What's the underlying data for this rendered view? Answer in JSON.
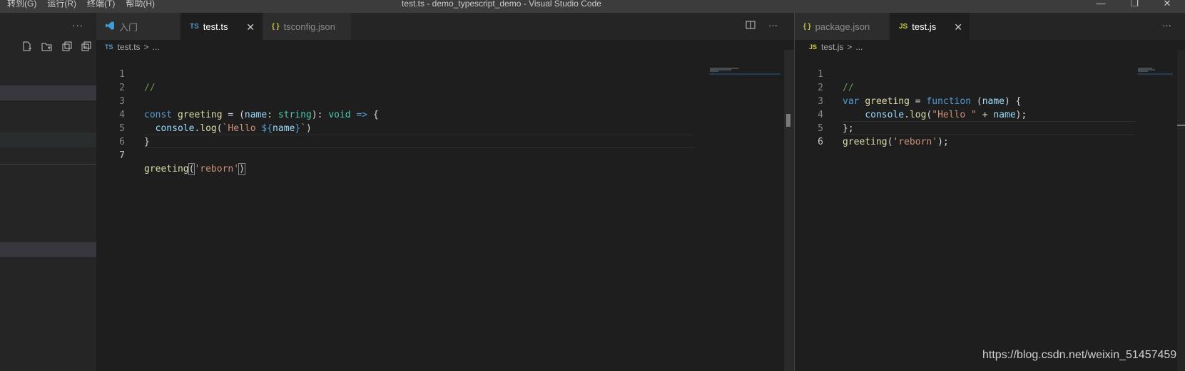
{
  "titlebar": {
    "menu": [
      "转到(G)",
      "运行(R)",
      "终端(T)",
      "帮助(H)"
    ],
    "title": "test.ts - demo_typescript_demo - Visual Studio Code",
    "controls": {
      "minimize": "—",
      "restore": "❐",
      "close": "✕"
    }
  },
  "sidebar": {
    "more": "···",
    "actions": [
      "new-file-icon",
      "new-folder-icon",
      "refresh-icon",
      "collapse-all-icon"
    ]
  },
  "left_group": {
    "tabs": [
      {
        "icon": "vscode-icon",
        "label": "入门"
      },
      {
        "icon": "TS",
        "label": "test.ts",
        "close": "✕"
      },
      {
        "icon": "{ }",
        "label": "tsconfig.json"
      }
    ],
    "actions": {
      "split": "split-editor-icon",
      "more": "···"
    },
    "breadcrumb": {
      "icon": "TS",
      "file": "test.ts",
      "sep": ">",
      "rest": "..."
    },
    "lines": [
      {
        "n": "1",
        "text": "//"
      },
      {
        "n": "2",
        "text": ""
      },
      {
        "n": "3",
        "text": "const greeting = (name: string): void => {"
      },
      {
        "n": "4",
        "text": "  console.log(`Hello ${name}`)"
      },
      {
        "n": "5",
        "text": "}"
      },
      {
        "n": "6",
        "text": ""
      },
      {
        "n": "7",
        "text": "greeting('reborn')"
      }
    ]
  },
  "right_group": {
    "tabs": [
      {
        "icon": "{ }",
        "label": "package.json"
      },
      {
        "icon": "JS",
        "label": "test.js",
        "close": "✕"
      }
    ],
    "actions": {
      "more": "···"
    },
    "breadcrumb": {
      "icon": "JS",
      "file": "test.js",
      "sep": ">",
      "rest": "..."
    },
    "lines": [
      {
        "n": "1",
        "text": "//"
      },
      {
        "n": "2",
        "text": "var greeting = function (name) {"
      },
      {
        "n": "3",
        "text": "    console.log(\"Hello \" + name);"
      },
      {
        "n": "4",
        "text": "};"
      },
      {
        "n": "5",
        "text": "greeting('reborn');"
      },
      {
        "n": "6",
        "text": ""
      }
    ]
  },
  "watermark": "https://blog.csdn.net/weixin_51457459",
  "colors": {
    "keyword": "#569cd6",
    "function": "#dcdcaa",
    "string": "#ce9178",
    "variable": "#9cdcfe",
    "type": "#4ec9b0",
    "comment": "#6a9955",
    "ts_icon": "#519aba",
    "js_icon": "#cbcb41",
    "json_icon": "#cbcb41"
  }
}
